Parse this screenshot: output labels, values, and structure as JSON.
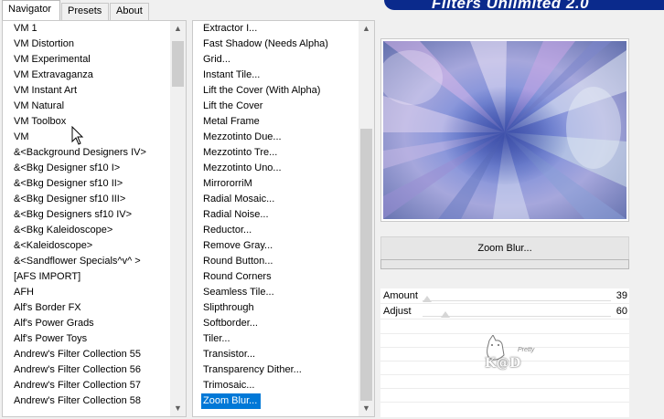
{
  "tabs": [
    {
      "label": "Navigator",
      "active": true
    },
    {
      "label": "Presets",
      "active": false
    },
    {
      "label": "About",
      "active": false
    }
  ],
  "banner": {
    "title": "Filters Unlimited 2.0"
  },
  "categories": [
    "VM 1",
    "VM Distortion",
    "VM Experimental",
    "VM Extravaganza",
    "VM Instant Art",
    "VM Natural",
    "VM Toolbox",
    "VM",
    "&<Background Designers IV>",
    "&<Bkg Designer sf10 I>",
    "&<Bkg Designer sf10 II>",
    "&<Bkg Designer sf10 III>",
    "&<Bkg Designers sf10 IV>",
    "&<Bkg Kaleidoscope>",
    "&<Kaleidoscope>",
    "&<Sandflower Specials^v^ >",
    "[AFS IMPORT]",
    "AFH",
    "Alf's Border FX",
    "Alf's Power Grads",
    "Alf's Power Toys",
    "Andrew's Filter Collection 55",
    "Andrew's Filter Collection 56",
    "Andrew's Filter Collection 57",
    "Andrew's Filter Collection 58"
  ],
  "filters": [
    "Extractor I...",
    "Fast Shadow (Needs Alpha)",
    "Grid...",
    "Instant Tile...",
    "Lift the Cover (With Alpha)",
    "Lift the Cover",
    "Metal Frame",
    "Mezzotinto Due...",
    "Mezzotinto Tre...",
    "Mezzotinto Uno...",
    "MirrororriM",
    "Radial Mosaic...",
    "Radial Noise...",
    "Reductor...",
    "Remove Gray...",
    "Round Button...",
    "Round Corners",
    "Seamless Tile...",
    "Slipthrough",
    "Softborder...",
    "Tiler...",
    "Transistor...",
    "Transparency Dither...",
    "Trimosaic...",
    "Zoom Blur..."
  ],
  "selected_filter_index": 24,
  "hovered_category": "VM Toolbox",
  "filter_name": "Zoom Blur...",
  "params": [
    {
      "label": "Amount",
      "value": "39"
    },
    {
      "label": "Adjust",
      "value": "60"
    }
  ],
  "watermark": {
    "text": "K@D",
    "small": "Pretty"
  },
  "icons": {
    "scroll_up": "chevron-up-icon",
    "scroll_down": "chevron-down-icon",
    "cursor": "mouse-pointer-icon"
  },
  "colors": {
    "selection": "#0078d7",
    "banner": "#0a2a8c"
  }
}
